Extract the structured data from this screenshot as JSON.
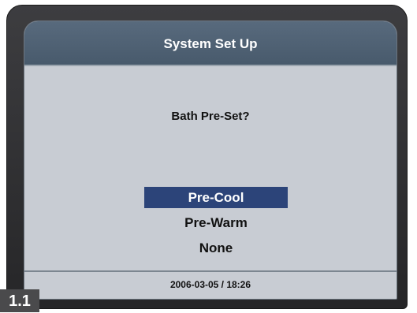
{
  "screen": {
    "title": "System Set Up",
    "question": "Bath Pre-Set?",
    "options": [
      {
        "label": "Pre-Cool",
        "selected": true
      },
      {
        "label": "Pre-Warm",
        "selected": false
      },
      {
        "label": "None",
        "selected": false
      }
    ],
    "datetime": "2006-03-05 / 18:26"
  },
  "figure_label": "1.1",
  "colors": {
    "title_bar": "#4f6175",
    "screen_bg": "#c8ccd3",
    "selection": "#2c4479",
    "bezel": "#2f2f31"
  }
}
